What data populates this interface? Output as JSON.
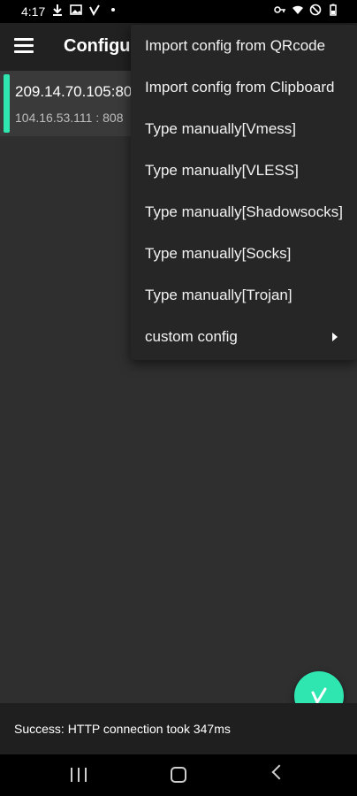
{
  "status_bar": {
    "time": "4:17",
    "left_icons": [
      "download-icon",
      "image-icon",
      "v2ray-icon",
      "dot-icon"
    ],
    "right_icons": [
      "key-icon",
      "wifi-icon",
      "dnd-icon",
      "battery-icon"
    ]
  },
  "toolbar": {
    "title": "Configur"
  },
  "server": {
    "host": "209.14.70.105:80",
    "address": "104.16.53.111 : 808"
  },
  "menu": {
    "items": [
      {
        "label": "Import config from QRcode"
      },
      {
        "label": "Import config from Clipboard"
      },
      {
        "label": "Type manually[Vmess]"
      },
      {
        "label": "Type manually[VLESS]"
      },
      {
        "label": "Type manually[Shadowsocks]"
      },
      {
        "label": "Type manually[Socks]"
      },
      {
        "label": "Type manually[Trojan]"
      },
      {
        "label": "custom config",
        "has_submenu": true
      }
    ]
  },
  "status_message": "Success: HTTP connection took 347ms",
  "colors": {
    "accent": "#2fe6b0",
    "background": "#2f2f2f",
    "toolbar": "#212121",
    "menu": "#262626"
  }
}
